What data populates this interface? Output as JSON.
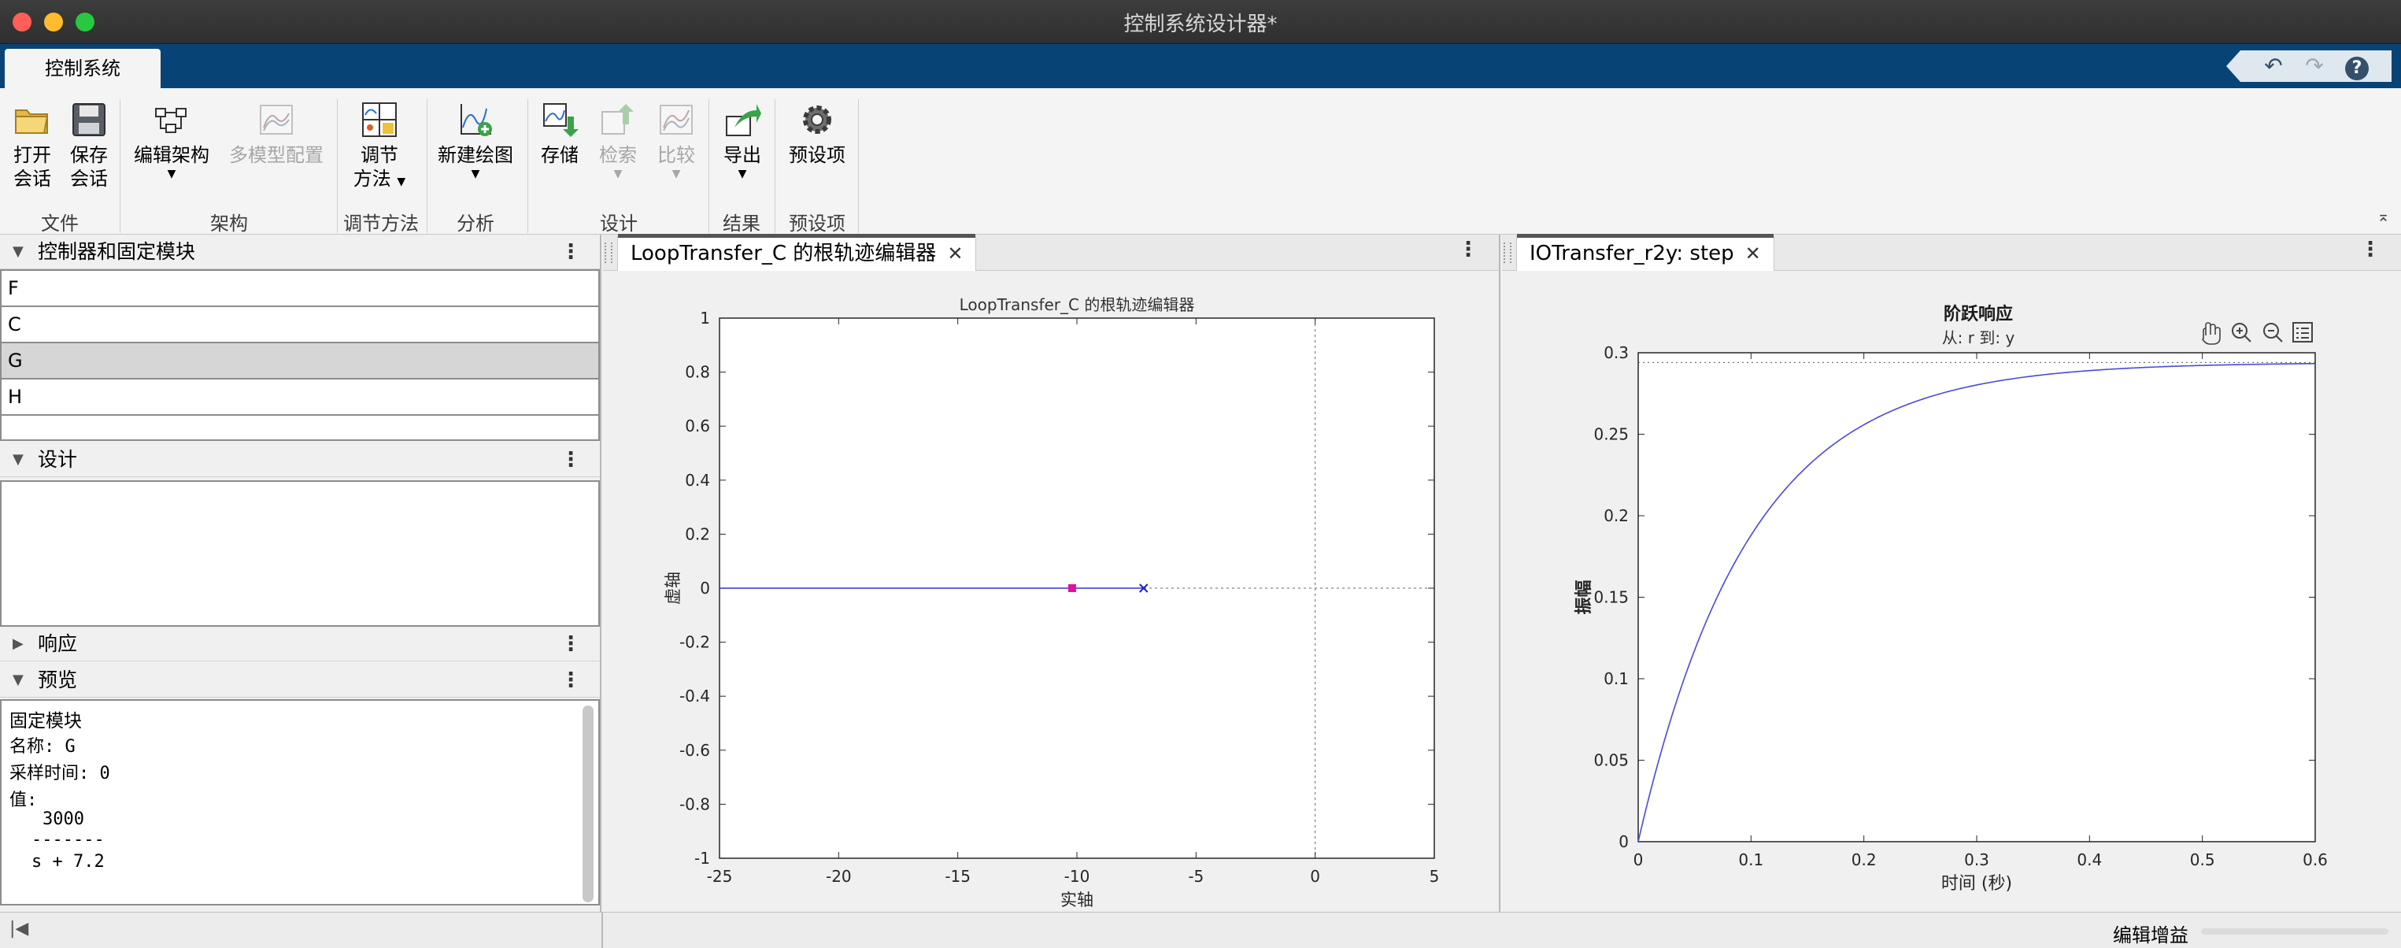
{
  "window": {
    "title": "控制系统设计器*"
  },
  "ribbon": {
    "tab": "控制系统"
  },
  "quick_access": {
    "undo": "↶",
    "redo": "↷",
    "help": "?"
  },
  "toolstrip": {
    "open": [
      "打开",
      "会话"
    ],
    "save": [
      "保存",
      "会话"
    ],
    "edit_arch": "编辑架构",
    "multi_model": "多模型配置",
    "tuning": [
      "调节",
      "方法"
    ],
    "new_plot": "新建绘图",
    "store": "存储",
    "retrieve": "检索",
    "compare": "比较",
    "export": "导出",
    "preferences": "预设项",
    "groups": {
      "file": "文件",
      "arch": "架构",
      "tuning": "调节方法",
      "analysis": "分析",
      "design": "设计",
      "results": "结果",
      "prefs": "预设项"
    }
  },
  "left_panel": {
    "controllers_title": "控制器和固定模块",
    "controllers": [
      "F",
      "C",
      "G",
      "H",
      ""
    ],
    "selected": "G",
    "design_title": "设计",
    "response_title": "响应",
    "preview_title": "预览",
    "preview": {
      "heading": "固定模块",
      "name_line": "名称: G",
      "sample_line": "采样时间: 0",
      "value_label": "值:",
      "numerator": "3000",
      "bar": "-------",
      "denominator": "s + 7.2"
    }
  },
  "root_locus_doc": {
    "tab": "LoopTransfer_C 的根轨迹编辑器",
    "close": "✕"
  },
  "step_doc": {
    "tab": "IOTransfer_r2y: step",
    "close": "✕"
  },
  "status": {
    "text": "编辑增益"
  },
  "chart_data": [
    {
      "type": "scatter",
      "title": "LoopTransfer_C 的根轨迹编辑器",
      "xlabel": "实轴",
      "ylabel": "虚轴",
      "xlim": [
        -25,
        5
      ],
      "ylim": [
        -1,
        1
      ],
      "xticks": [
        -25,
        -20,
        -15,
        -10,
        -5,
        0,
        5
      ],
      "yticks": [
        -1,
        -0.8,
        -0.6,
        -0.4,
        -0.2,
        0,
        0.2,
        0.4,
        0.6,
        0.8,
        1
      ],
      "series": [
        {
          "values": [
            [
              -25,
              0
            ],
            [
              -7.2,
              0
            ]
          ]
        }
      ],
      "pole": [
        -7.2,
        0
      ],
      "closed_loop_pole": [
        -10.2,
        0
      ],
      "grid": false
    },
    {
      "type": "line",
      "title": "阶跃响应",
      "subtitle": "从: r  到: y",
      "xlabel": "时间 (秒)",
      "ylabel": "振幅",
      "xlim": [
        0,
        0.6
      ],
      "ylim": [
        0,
        0.3
      ],
      "xticks": [
        0,
        0.1,
        0.2,
        0.3,
        0.4,
        0.5,
        0.6
      ],
      "yticks": [
        0,
        0.05,
        0.1,
        0.15,
        0.2,
        0.25,
        0.3
      ],
      "final_value": 0.294,
      "time_constant": 0.098,
      "grid": false
    }
  ]
}
